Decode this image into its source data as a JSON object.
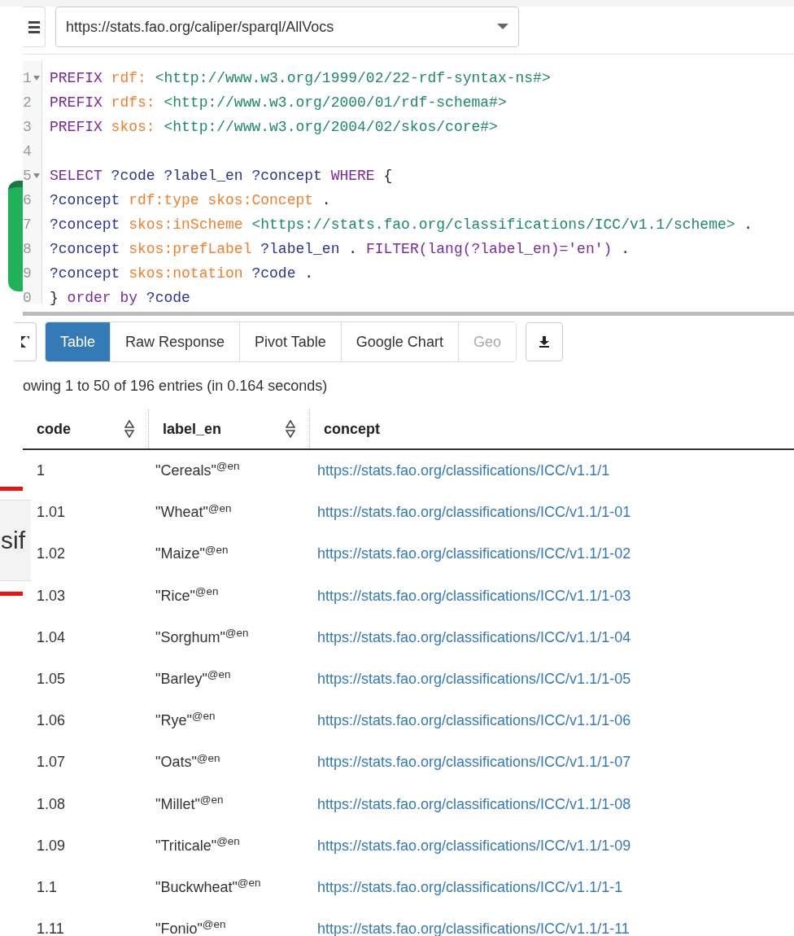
{
  "overlay": {
    "text": "sif"
  },
  "endpoint": {
    "value": "https://stats.fao.org/caliper/sparql/AllVocs"
  },
  "editor": {
    "lines": [
      {
        "number": "1",
        "fold": true,
        "tokens": [
          {
            "kind": "keyword",
            "text": "PREFIX"
          },
          {
            "kind": "prefix",
            "text": "rdf:"
          },
          {
            "kind": "uri",
            "text": "<http://www.w3.org/1999/02/22-rdf-syntax-ns#>"
          }
        ]
      },
      {
        "number": "2",
        "fold": false,
        "tokens": [
          {
            "kind": "keyword",
            "text": "PREFIX"
          },
          {
            "kind": "prefix",
            "text": "rdfs:"
          },
          {
            "kind": "uri",
            "text": "<http://www.w3.org/2000/01/rdf-schema#>"
          }
        ]
      },
      {
        "number": "3",
        "fold": false,
        "tokens": [
          {
            "kind": "keyword",
            "text": "PREFIX"
          },
          {
            "kind": "prefix",
            "text": "skos:"
          },
          {
            "kind": "uri",
            "text": "<http://www.w3.org/2004/02/skos/core#>"
          }
        ]
      },
      {
        "number": "4",
        "fold": false
      },
      {
        "number": "5",
        "fold": true,
        "tokens": [
          {
            "kind": "keyword",
            "text": "SELECT"
          },
          {
            "kind": "var",
            "text": "?code"
          },
          {
            "kind": "var",
            "text": "?label_en"
          },
          {
            "kind": "var",
            "text": "?concept"
          },
          {
            "kind": "keyword",
            "text": "WHERE"
          },
          {
            "kind": "punct",
            "text": "{"
          }
        ]
      },
      {
        "number": "6",
        "fold": false,
        "tokens": [
          {
            "kind": "var",
            "text": "?concept"
          },
          {
            "kind": "prefix",
            "text": "rdf:type"
          },
          {
            "kind": "prefix",
            "text": "skos:Concept"
          },
          {
            "kind": "punct",
            "text": "."
          }
        ]
      },
      {
        "number": "7",
        "fold": false,
        "tokens": [
          {
            "kind": "var",
            "text": "?concept"
          },
          {
            "kind": "prefix",
            "text": "skos:inScheme"
          },
          {
            "kind": "uri",
            "text": "<https://stats.fao.org/classifications/ICC/v1.1/scheme>"
          },
          {
            "kind": "punct",
            "text": "."
          }
        ]
      },
      {
        "number": "8",
        "fold": false,
        "tokens": [
          {
            "kind": "var",
            "text": "?concept"
          },
          {
            "kind": "prefix",
            "text": "skos:prefLabel"
          },
          {
            "kind": "var",
            "text": "?label_en"
          },
          {
            "kind": "punct",
            "text": "."
          },
          {
            "kind": "keyword",
            "text": "FILTER(lang(?label_en)='en')"
          },
          {
            "kind": "punct",
            "text": "."
          }
        ]
      },
      {
        "number": "9",
        "fold": false,
        "tokens": [
          {
            "kind": "var",
            "text": "?concept"
          },
          {
            "kind": "prefix",
            "text": "skos:notation"
          },
          {
            "kind": "var",
            "text": "?code"
          },
          {
            "kind": "punct",
            "text": "."
          }
        ]
      },
      {
        "number": "0",
        "fold": false,
        "tokens": [
          {
            "kind": "punct",
            "text": "}"
          },
          {
            "kind": "keyword",
            "text": "order by"
          },
          {
            "kind": "var",
            "text": "?code"
          }
        ]
      }
    ]
  },
  "tabs": [
    {
      "label": "Table",
      "selected": true,
      "disabled": false
    },
    {
      "label": "Raw Response",
      "selected": false,
      "disabled": false
    },
    {
      "label": "Pivot Table",
      "selected": false,
      "disabled": false
    },
    {
      "label": "Google Chart",
      "selected": false,
      "disabled": false
    },
    {
      "label": "Geo",
      "selected": false,
      "disabled": true
    }
  ],
  "status": "owing 1 to 50 of 196 entries (in 0.164 seconds)",
  "table": {
    "columns": [
      {
        "label": "code",
        "sortable": true
      },
      {
        "label": "label_en",
        "sortable": true
      },
      {
        "label": "concept",
        "sortable": false
      }
    ],
    "rows": [
      {
        "code": "1",
        "label_en": "\"Cereals\"$^{@en}$",
        "concept": "https://stats.fao.org/classifications/ICC/v1.1/1"
      },
      {
        "code": "1.01",
        "label_en": "\"Wheat\"$^{@en}$",
        "concept": "https://stats.fao.org/classifications/ICC/v1.1/1-01"
      },
      {
        "code": "1.02",
        "label_en": "\"Maize\"$^{@en}$",
        "concept": "https://stats.fao.org/classifications/ICC/v1.1/1-02"
      },
      {
        "code": "1.03",
        "label_en": "\"Rice\"$^{@en}$",
        "concept": "https://stats.fao.org/classifications/ICC/v1.1/1-03"
      },
      {
        "code": "1.04",
        "label_en": "\"Sorghum\"$^{@en}$",
        "concept": "https://stats.fao.org/classifications/ICC/v1.1/1-04"
      },
      {
        "code": "1.05",
        "label_en": "\"Barley\"$^{@en}$",
        "concept": "https://stats.fao.org/classifications/ICC/v1.1/1-05"
      },
      {
        "code": "1.06",
        "label_en": "\"Rye\"$^{@en}$",
        "concept": "https://stats.fao.org/classifications/ICC/v1.1/1-06"
      },
      {
        "code": "1.07",
        "label_en": "\"Oats\"$^{@en}$",
        "concept": "https://stats.fao.org/classifications/ICC/v1.1/1-07"
      },
      {
        "code": "1.08",
        "label_en": "\"Millet\"$^{@en}$",
        "concept": "https://stats.fao.org/classifications/ICC/v1.1/1-08"
      },
      {
        "code": "1.09",
        "label_en": "\"Triticale\"$^{@en}$",
        "concept": "https://stats.fao.org/classifications/ICC/v1.1/1-09"
      },
      {
        "code": "1.1",
        "label_en": "\"Buckwheat\"$^{@en}$",
        "concept": "https://stats.fao.org/classifications/ICC/v1.1/1-1"
      },
      {
        "code": "1.11",
        "label_en": "\"Fonio\"$^{@en}$",
        "concept": "https://stats.fao.org/classifications/ICC/v1.1/1-11"
      }
    ]
  }
}
